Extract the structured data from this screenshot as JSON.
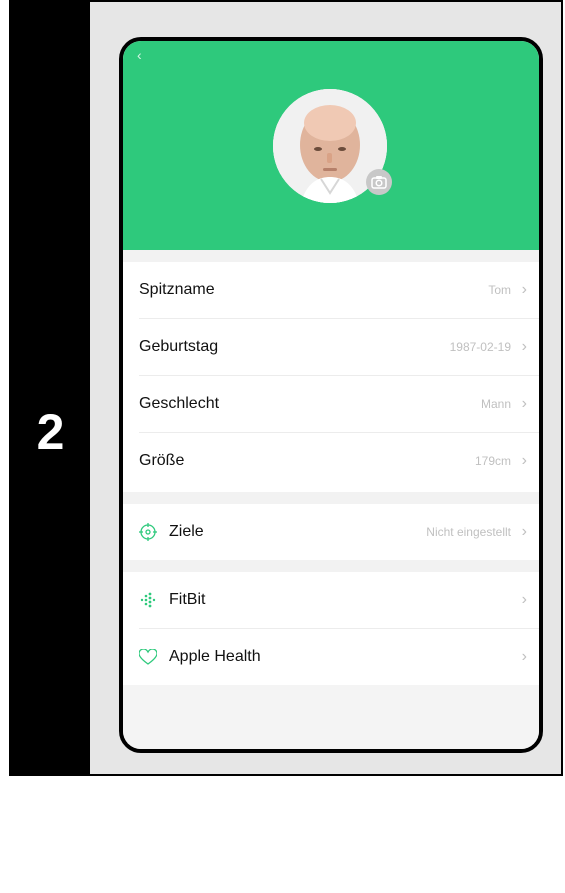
{
  "step": {
    "number": "2"
  },
  "profile": {
    "icons": {
      "back": "chevron-left-icon",
      "camera": "camera-icon"
    }
  },
  "rows": {
    "nickname": {
      "label": "Spitzname",
      "value": "Tom"
    },
    "birthday": {
      "label": "Geburtstag",
      "value": "1987-02-19"
    },
    "gender": {
      "label": "Geschlecht",
      "value": "Mann"
    },
    "height": {
      "label": "Größe",
      "value": "179cm"
    },
    "goals": {
      "label": "Ziele",
      "value": "Nicht eingestellt",
      "icon": "target-icon"
    },
    "fitbit": {
      "label": "FitBit",
      "icon": "fitbit-icon"
    },
    "apple_health": {
      "label": "Apple Health",
      "icon": "heart-icon"
    }
  },
  "colors": {
    "accent": "#2ec97c",
    "value_text": "#c0c0c0",
    "step_bar": "#000000",
    "frame_bg": "#e6e6e6"
  }
}
